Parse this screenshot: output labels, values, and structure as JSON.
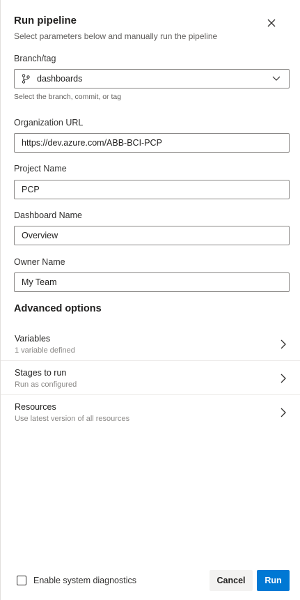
{
  "header": {
    "title": "Run pipeline",
    "subtitle": "Select parameters below and manually run the pipeline",
    "close_icon": "close-icon"
  },
  "branch": {
    "label": "Branch/tag",
    "value": "dashboards",
    "icon": "git-branch-icon",
    "helper": "Select the branch, commit, or tag"
  },
  "fields": {
    "org_url": {
      "label": "Organization URL",
      "value": "https://dev.azure.com/ABB-BCI-PCP"
    },
    "project": {
      "label": "Project Name",
      "value": "PCP"
    },
    "dashboard": {
      "label": "Dashboard Name",
      "value": "Overview"
    },
    "owner": {
      "label": "Owner Name",
      "value": "My Team"
    }
  },
  "advanced": {
    "heading": "Advanced options",
    "items": [
      {
        "title": "Variables",
        "subtitle": "1 variable defined"
      },
      {
        "title": "Stages to run",
        "subtitle": "Run as configured"
      },
      {
        "title": "Resources",
        "subtitle": "Use latest version of all resources"
      }
    ]
  },
  "footer": {
    "diagnostics_label": "Enable system diagnostics",
    "diagnostics_checked": false,
    "cancel_label": "Cancel",
    "run_label": "Run"
  },
  "colors": {
    "primary": "#0078d4",
    "border": "#8a8886",
    "secondary_text": "#605e5c"
  }
}
